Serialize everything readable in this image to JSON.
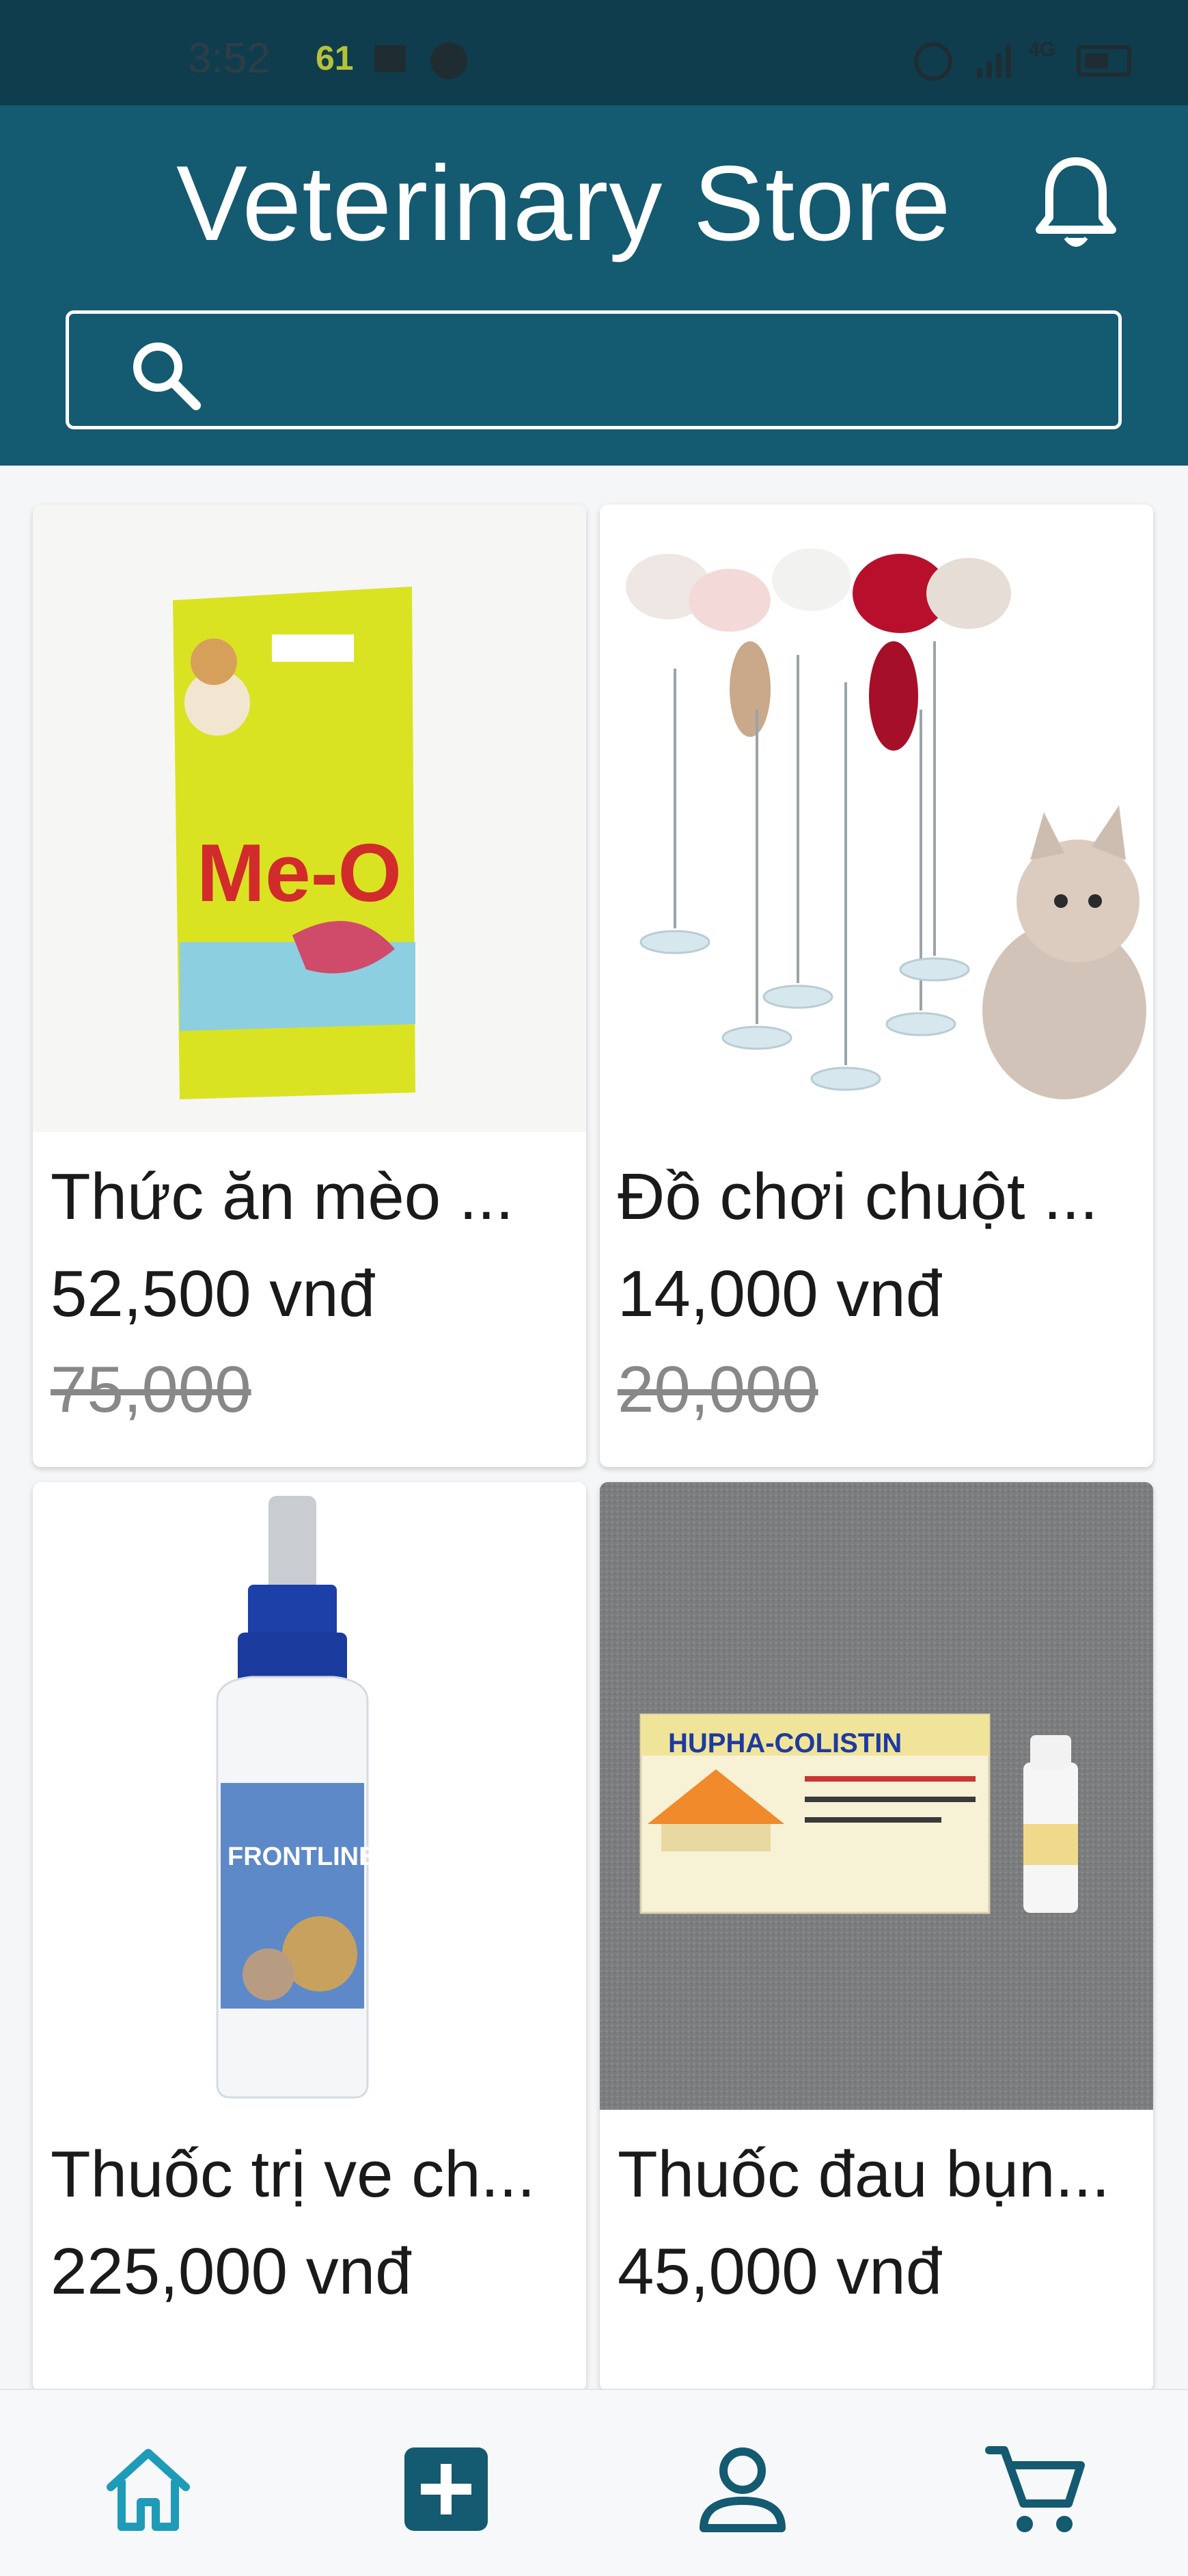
{
  "status_bar": {
    "time": "3:52",
    "battery_level": "61",
    "network": "4G"
  },
  "header": {
    "title": "Veterinary Store",
    "search_placeholder": ""
  },
  "products": [
    {
      "name": "Thức ăn mèo ...",
      "price": "52,500 vnđ",
      "old_price": "75,000",
      "image": "cat-food-bag"
    },
    {
      "name": "Đồ chơi chuột ...",
      "price": "14,000 vnđ",
      "old_price": "20,000",
      "image": "mouse-toy"
    },
    {
      "name": "Thuốc trị ve ch...",
      "price": "225,000 vnđ",
      "old_price": "",
      "image": "frontline-spray"
    },
    {
      "name": "Thuốc đau bụn...",
      "price": "45,000 vnđ",
      "old_price": "",
      "image": "hupha-colistin-box"
    }
  ],
  "product_images": {
    "cat_food_brand": "Me-O",
    "spray_brand": "FRONTLINE",
    "medicine_brand": "HUPHA-COLISTIN"
  },
  "bottom_nav": {
    "items": [
      "home-icon",
      "add-icon",
      "profile-icon",
      "cart-icon"
    ]
  },
  "colors": {
    "header": "#145a70",
    "status_bar": "#0f3d4d",
    "nav_active": "#1e9bb8",
    "nav_inactive": "#145a70"
  }
}
